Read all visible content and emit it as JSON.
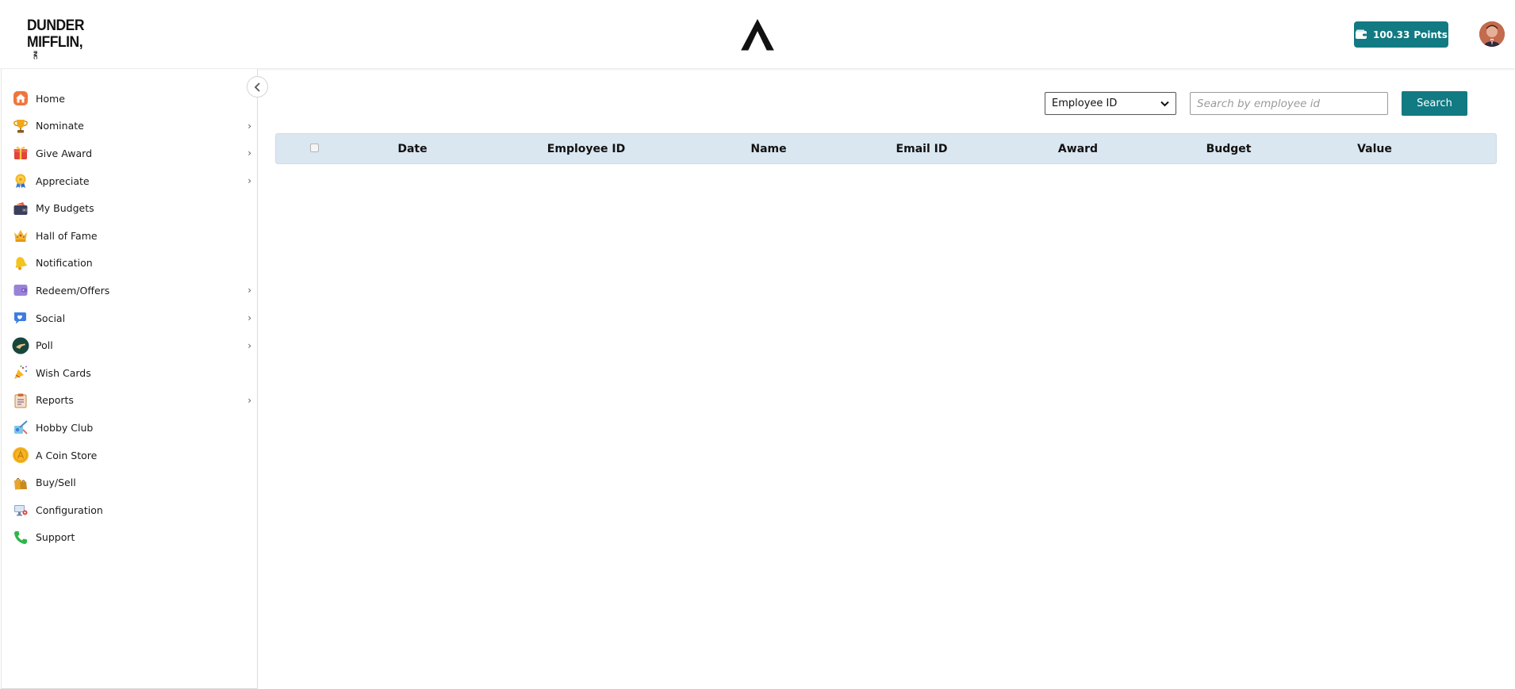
{
  "header": {
    "logo_line1": "DUNDER",
    "logo_line2": "MIFFLIN,",
    "logo_suffix": "INC",
    "points_value": "100.33",
    "points_label": "Points"
  },
  "sidebar": {
    "items": [
      {
        "label": "Home",
        "icon": "home-icon",
        "has_submenu": false
      },
      {
        "label": "Nominate",
        "icon": "trophy-icon",
        "has_submenu": true
      },
      {
        "label": "Give Award",
        "icon": "gift-icon",
        "has_submenu": true
      },
      {
        "label": "Appreciate",
        "icon": "medal-icon",
        "has_submenu": true
      },
      {
        "label": "My Budgets",
        "icon": "wallet-icon",
        "has_submenu": false
      },
      {
        "label": "Hall of Fame",
        "icon": "crown-icon",
        "has_submenu": false
      },
      {
        "label": "Notification",
        "icon": "bell-icon",
        "has_submenu": false
      },
      {
        "label": "Redeem/Offers",
        "icon": "purse-icon",
        "has_submenu": true
      },
      {
        "label": "Social",
        "icon": "chat-icon",
        "has_submenu": true
      },
      {
        "label": "Poll",
        "icon": "poll-icon",
        "has_submenu": true
      },
      {
        "label": "Wish Cards",
        "icon": "party-popper-icon",
        "has_submenu": false
      },
      {
        "label": "Reports",
        "icon": "clipboard-icon",
        "has_submenu": true
      },
      {
        "label": "Hobby Club",
        "icon": "hobby-icon",
        "has_submenu": false
      },
      {
        "label": "A Coin Store",
        "icon": "coin-icon",
        "has_submenu": false
      },
      {
        "label": "Buy/Sell",
        "icon": "shopping-bags-icon",
        "has_submenu": false
      },
      {
        "label": "Configuration",
        "icon": "settings-monitor-icon",
        "has_submenu": false
      },
      {
        "label": "Support",
        "icon": "phone-icon",
        "has_submenu": false
      }
    ]
  },
  "filter": {
    "selected": "Employee ID",
    "search_placeholder": "Search by employee id",
    "search_label": "Search"
  },
  "table": {
    "columns": [
      "Date",
      "Employee ID",
      "Name",
      "Email ID",
      "Award",
      "Budget",
      "Value"
    ]
  },
  "colors": {
    "accent": "#117a82",
    "table_header_bg": "#dae6f0"
  }
}
